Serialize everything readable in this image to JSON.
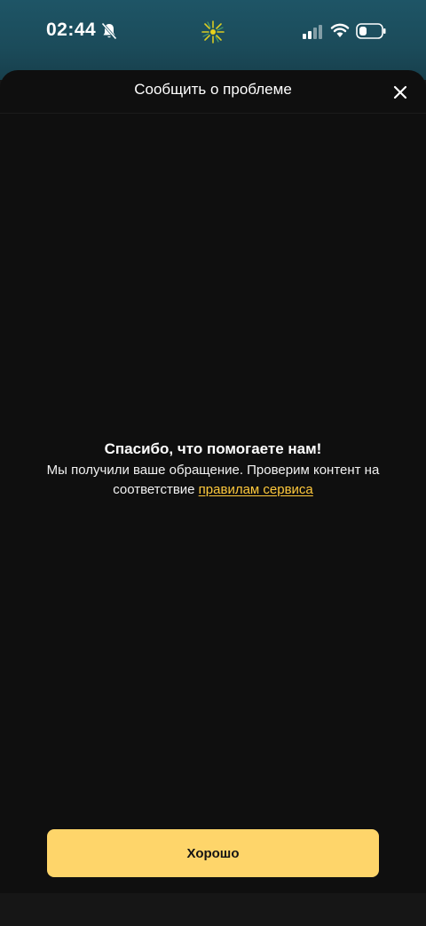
{
  "status_bar": {
    "time": "02:44",
    "icons": [
      "bell-muted-icon",
      "app-logo-icon",
      "signal-icon",
      "wifi-icon",
      "battery-icon"
    ]
  },
  "sheet": {
    "title": "Сообщить о проблеме",
    "close_icon": "close-icon"
  },
  "message": {
    "title": "Спасибо, что помогаете нам!",
    "body": "Мы получили ваше обращение. Проверим контент на соответствие ",
    "link": "правилам сервиса"
  },
  "actions": {
    "ok_label": "Хорошо"
  },
  "colors": {
    "accent": "#fed56a",
    "link": "#ffc93c",
    "sheet_bg": "#0f0f0f",
    "status_bg": "#1b4b5a"
  }
}
